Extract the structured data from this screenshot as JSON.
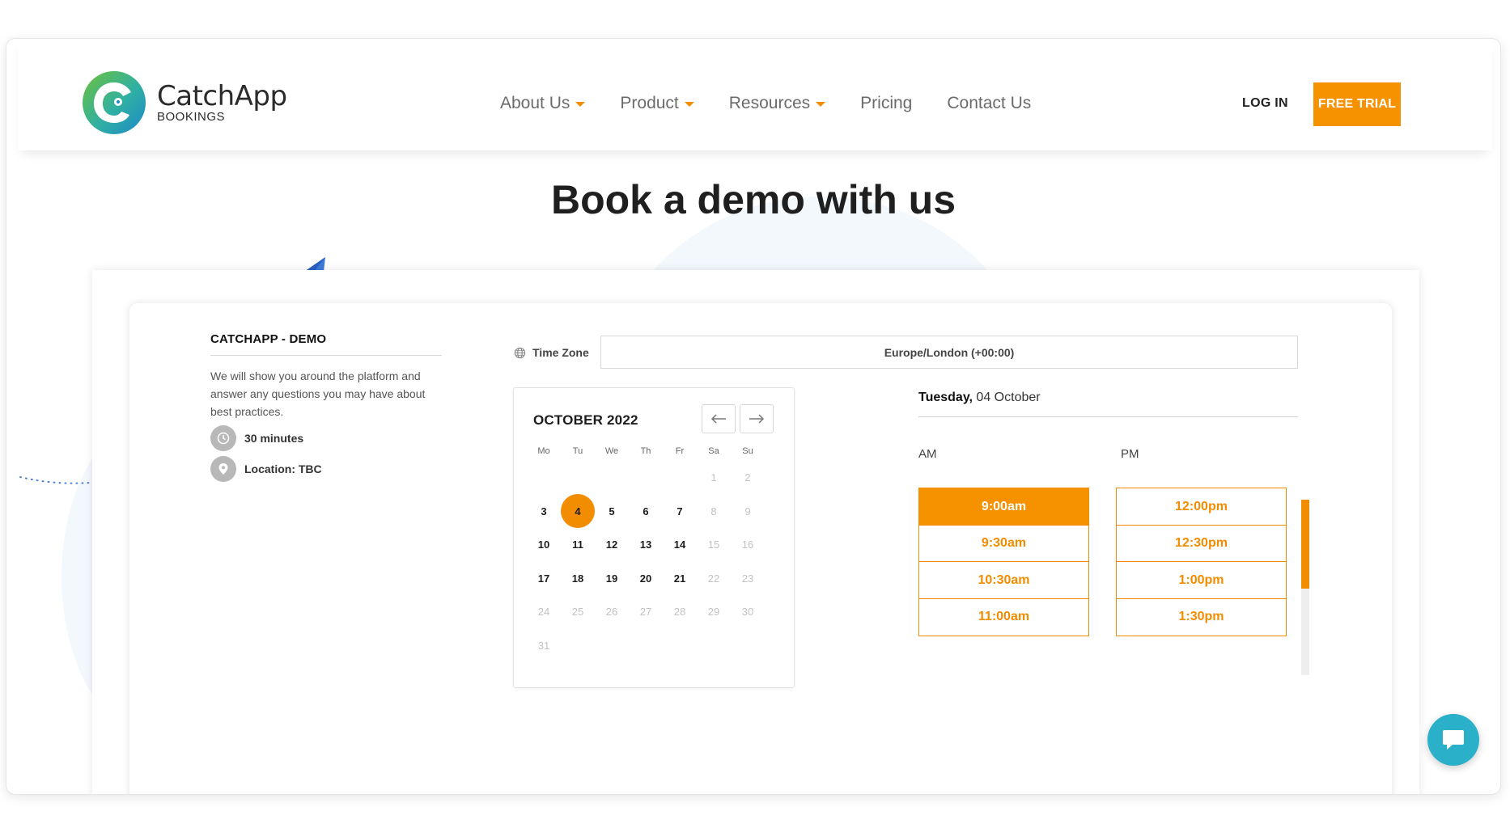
{
  "brand": {
    "name": "CatchApp",
    "sub": "BOOKINGS"
  },
  "nav": [
    {
      "label": "About Us",
      "dropdown": true
    },
    {
      "label": "Product",
      "dropdown": true
    },
    {
      "label": "Resources",
      "dropdown": true
    },
    {
      "label": "Pricing",
      "dropdown": false
    },
    {
      "label": "Contact Us",
      "dropdown": false
    }
  ],
  "header": {
    "login": "LOG IN",
    "free_trial": "FREE TRIAL"
  },
  "page": {
    "title": "Book a demo with us"
  },
  "event": {
    "title": "CATCHAPP - DEMO",
    "description": "We will show you around the platform and answer any questions you may have about best practices.",
    "duration": "30 minutes",
    "location": "Location: TBC"
  },
  "timezone": {
    "label": "Time Zone",
    "value": "Europe/London (+00:00)"
  },
  "calendar": {
    "month": "OCTOBER 2022",
    "weekdays": [
      "Mo",
      "Tu",
      "We",
      "Th",
      "Fr",
      "Sa",
      "Su"
    ],
    "weeks": [
      [
        "",
        "",
        "",
        "",
        "",
        "1",
        "2"
      ],
      [
        "3",
        "4",
        "5",
        "6",
        "7",
        "8",
        "9"
      ],
      [
        "10",
        "11",
        "12",
        "13",
        "14",
        "15",
        "16"
      ],
      [
        "17",
        "18",
        "19",
        "20",
        "21",
        "22",
        "23"
      ],
      [
        "24",
        "25",
        "26",
        "27",
        "28",
        "29",
        "30"
      ],
      [
        "31",
        "",
        "",
        "",
        "",
        "",
        ""
      ]
    ],
    "available": [
      "3",
      "4",
      "5",
      "6",
      "7",
      "10",
      "11",
      "12",
      "13",
      "14",
      "17",
      "18",
      "19",
      "20",
      "21"
    ],
    "selected": "4"
  },
  "times": {
    "date_day": "Tuesday,",
    "date_rest": " 04 October",
    "am_label": "AM",
    "pm_label": "PM",
    "am": [
      "9:00am",
      "9:30am",
      "10:30am",
      "11:00am"
    ],
    "pm": [
      "12:00pm",
      "12:30pm",
      "1:00pm",
      "1:30pm"
    ],
    "selected": "9:00am"
  },
  "colors": {
    "accent": "#f69100",
    "chat": "#2ab0c8"
  },
  "icons": {
    "globe": "globe-icon",
    "clock": "clock-icon",
    "location": "location-pin-icon",
    "chat": "chat-bubble-icon"
  }
}
